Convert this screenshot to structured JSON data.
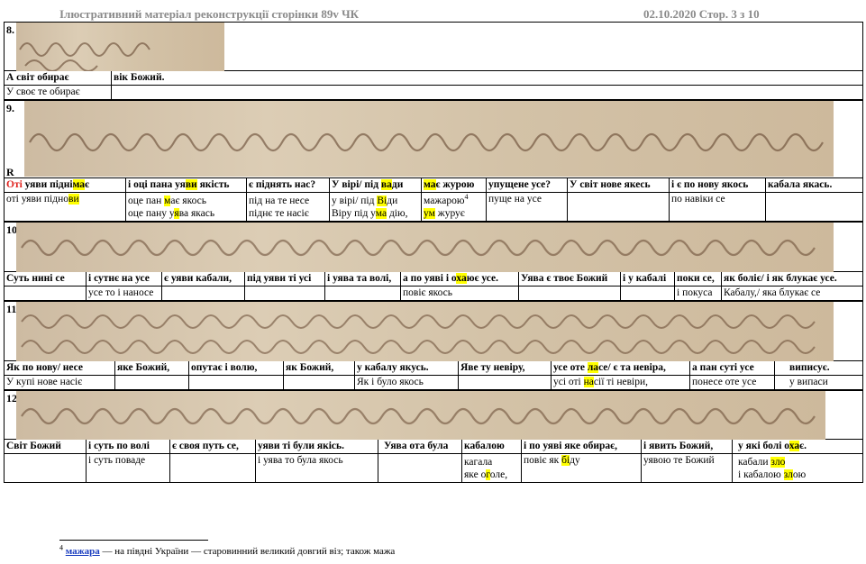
{
  "header": {
    "left": "Ілюстративний матеріал  реконструкції сторінки 89v ЧК",
    "right": "02.10.2020  Стор. 3 з 10"
  },
  "s8": {
    "num": "8.",
    "bold": [
      "А світ обирає",
      "вік Божий."
    ],
    "plain": [
      "У своє те обирає"
    ]
  },
  "s9": {
    "num": "9.",
    "marker": "R",
    "bold": [
      "Оті",
      " уяви підні",
      "ма",
      "є",
      "і оці пана уя",
      "ви",
      " якість",
      "є піднять нас?",
      "У вірі/ під ",
      "ва",
      "ди",
      "ма",
      "є журою",
      "упущене усе?",
      "У світ нове якесь",
      "і є по нову якось",
      "кабала якась."
    ],
    "p1": [
      "оті уяви підно",
      "ви",
      "оце пан ",
      "м",
      "ає якось",
      "під на те несе",
      "у вірі/ під ",
      "Вi",
      "ди",
      "мажарою",
      "4",
      "пуще на усе",
      "по навіки се"
    ],
    "p2": [
      "оце пану у",
      "я",
      "ва якась",
      "піднє те насіє",
      "Віру під у",
      "ма",
      " дію,",
      "ум",
      " журує"
    ]
  },
  "s10": {
    "num": "10",
    "bold": [
      "Суть нині се",
      "і сутнє на усе",
      "є уяви кабали,",
      "під уяви ті усі",
      "і уява та волі,",
      "а по уяві і о",
      "ха",
      "ює усе.",
      "Уява є твоє Божий",
      "і у кабалі",
      "поки се,",
      "як боліє/ і як блукає усе."
    ],
    "plain": [
      "усе то і наносе",
      "повіє якось",
      "і покуса",
      "Кабалу,/ яка блукає се"
    ]
  },
  "s11": {
    "num": "11",
    "bold": [
      "Як по нову/ несе",
      "яке Божий,",
      "опутає і волю,",
      "як Божий,",
      "у кабалу якусь.",
      "Яве ту невіру,",
      "усе оте ",
      "ла",
      "се/ є та невіра,",
      "а пан суті усе",
      "виписує."
    ],
    "plain": [
      "У купі нове насіє",
      "Як і було якось",
      "усі оті ",
      "на",
      "сії ті невіри,",
      "понесе оте усе",
      "у випаси"
    ]
  },
  "s12": {
    "num": "12",
    "bold": [
      "Світ Божий",
      "і суть по волі",
      "є своя путь се,",
      "уяви ті були якісь.",
      "Уява ота була",
      "кабалою",
      "і по уяві яке обирає,",
      "і явить Божий,",
      "у які болі о",
      "ха",
      "є."
    ],
    "p1": [
      "і суть поваде",
      "і уява то була якось",
      "кагала",
      "повіє як ",
      "бі",
      "ду",
      "уявою те Божий",
      "кабали ",
      "зло"
    ],
    "p2": [
      "яке о",
      "г",
      "оле,",
      "і кабалою ",
      "зл",
      "ою"
    ]
  },
  "footnote": {
    "num": "4",
    "term": "мажара",
    "text": "  — на півдні України — старовинний великий довгий віз; також мажа"
  }
}
